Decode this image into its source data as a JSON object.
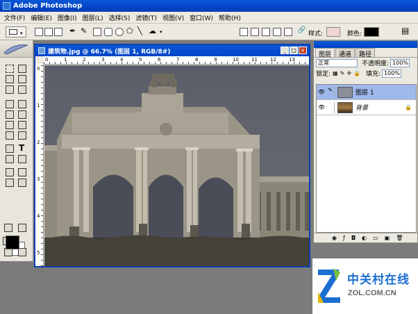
{
  "app": {
    "title": "Adobe Photoshop"
  },
  "menu": [
    "文件(F)",
    "编辑(E)",
    "图像(I)",
    "图层(L)",
    "选择(S)",
    "滤镜(T)",
    "视图(V)",
    "窗口(W)",
    "帮助(H)"
  ],
  "options_bar": {
    "style_label": "样式:",
    "color_label": "颜色:"
  },
  "document": {
    "title": "建筑物.jpg @ 66.7% (图层 1, RGB/8#)",
    "ruler_h_numbers": [
      "0",
      "1",
      "2",
      "3",
      "4",
      "5",
      "6",
      "7",
      "8",
      "9",
      "10",
      "11",
      "12",
      "13"
    ],
    "ruler_v_numbers": [
      "0",
      "1",
      "2",
      "3",
      "4",
      "5"
    ]
  },
  "layers_panel": {
    "tabs": [
      "图层",
      "通道",
      "路径"
    ],
    "blend_mode": "正常",
    "opacity_label": "不透明度:",
    "opacity_value": "100%",
    "lock_label": "锁定:",
    "fill_label": "填充:",
    "fill_value": "100%",
    "layers": [
      {
        "name": "图层 1",
        "active": true
      },
      {
        "name": "背景",
        "active": false
      }
    ]
  },
  "watermark": {
    "cn": "中关村在线",
    "en": "ZOL.COM.CN"
  },
  "colors": {
    "title_blue": "#0a4fd0",
    "canvas_gray": "#5c5f68",
    "logo_blue": "#1b6fd1",
    "logo_green": "#7cc142"
  }
}
